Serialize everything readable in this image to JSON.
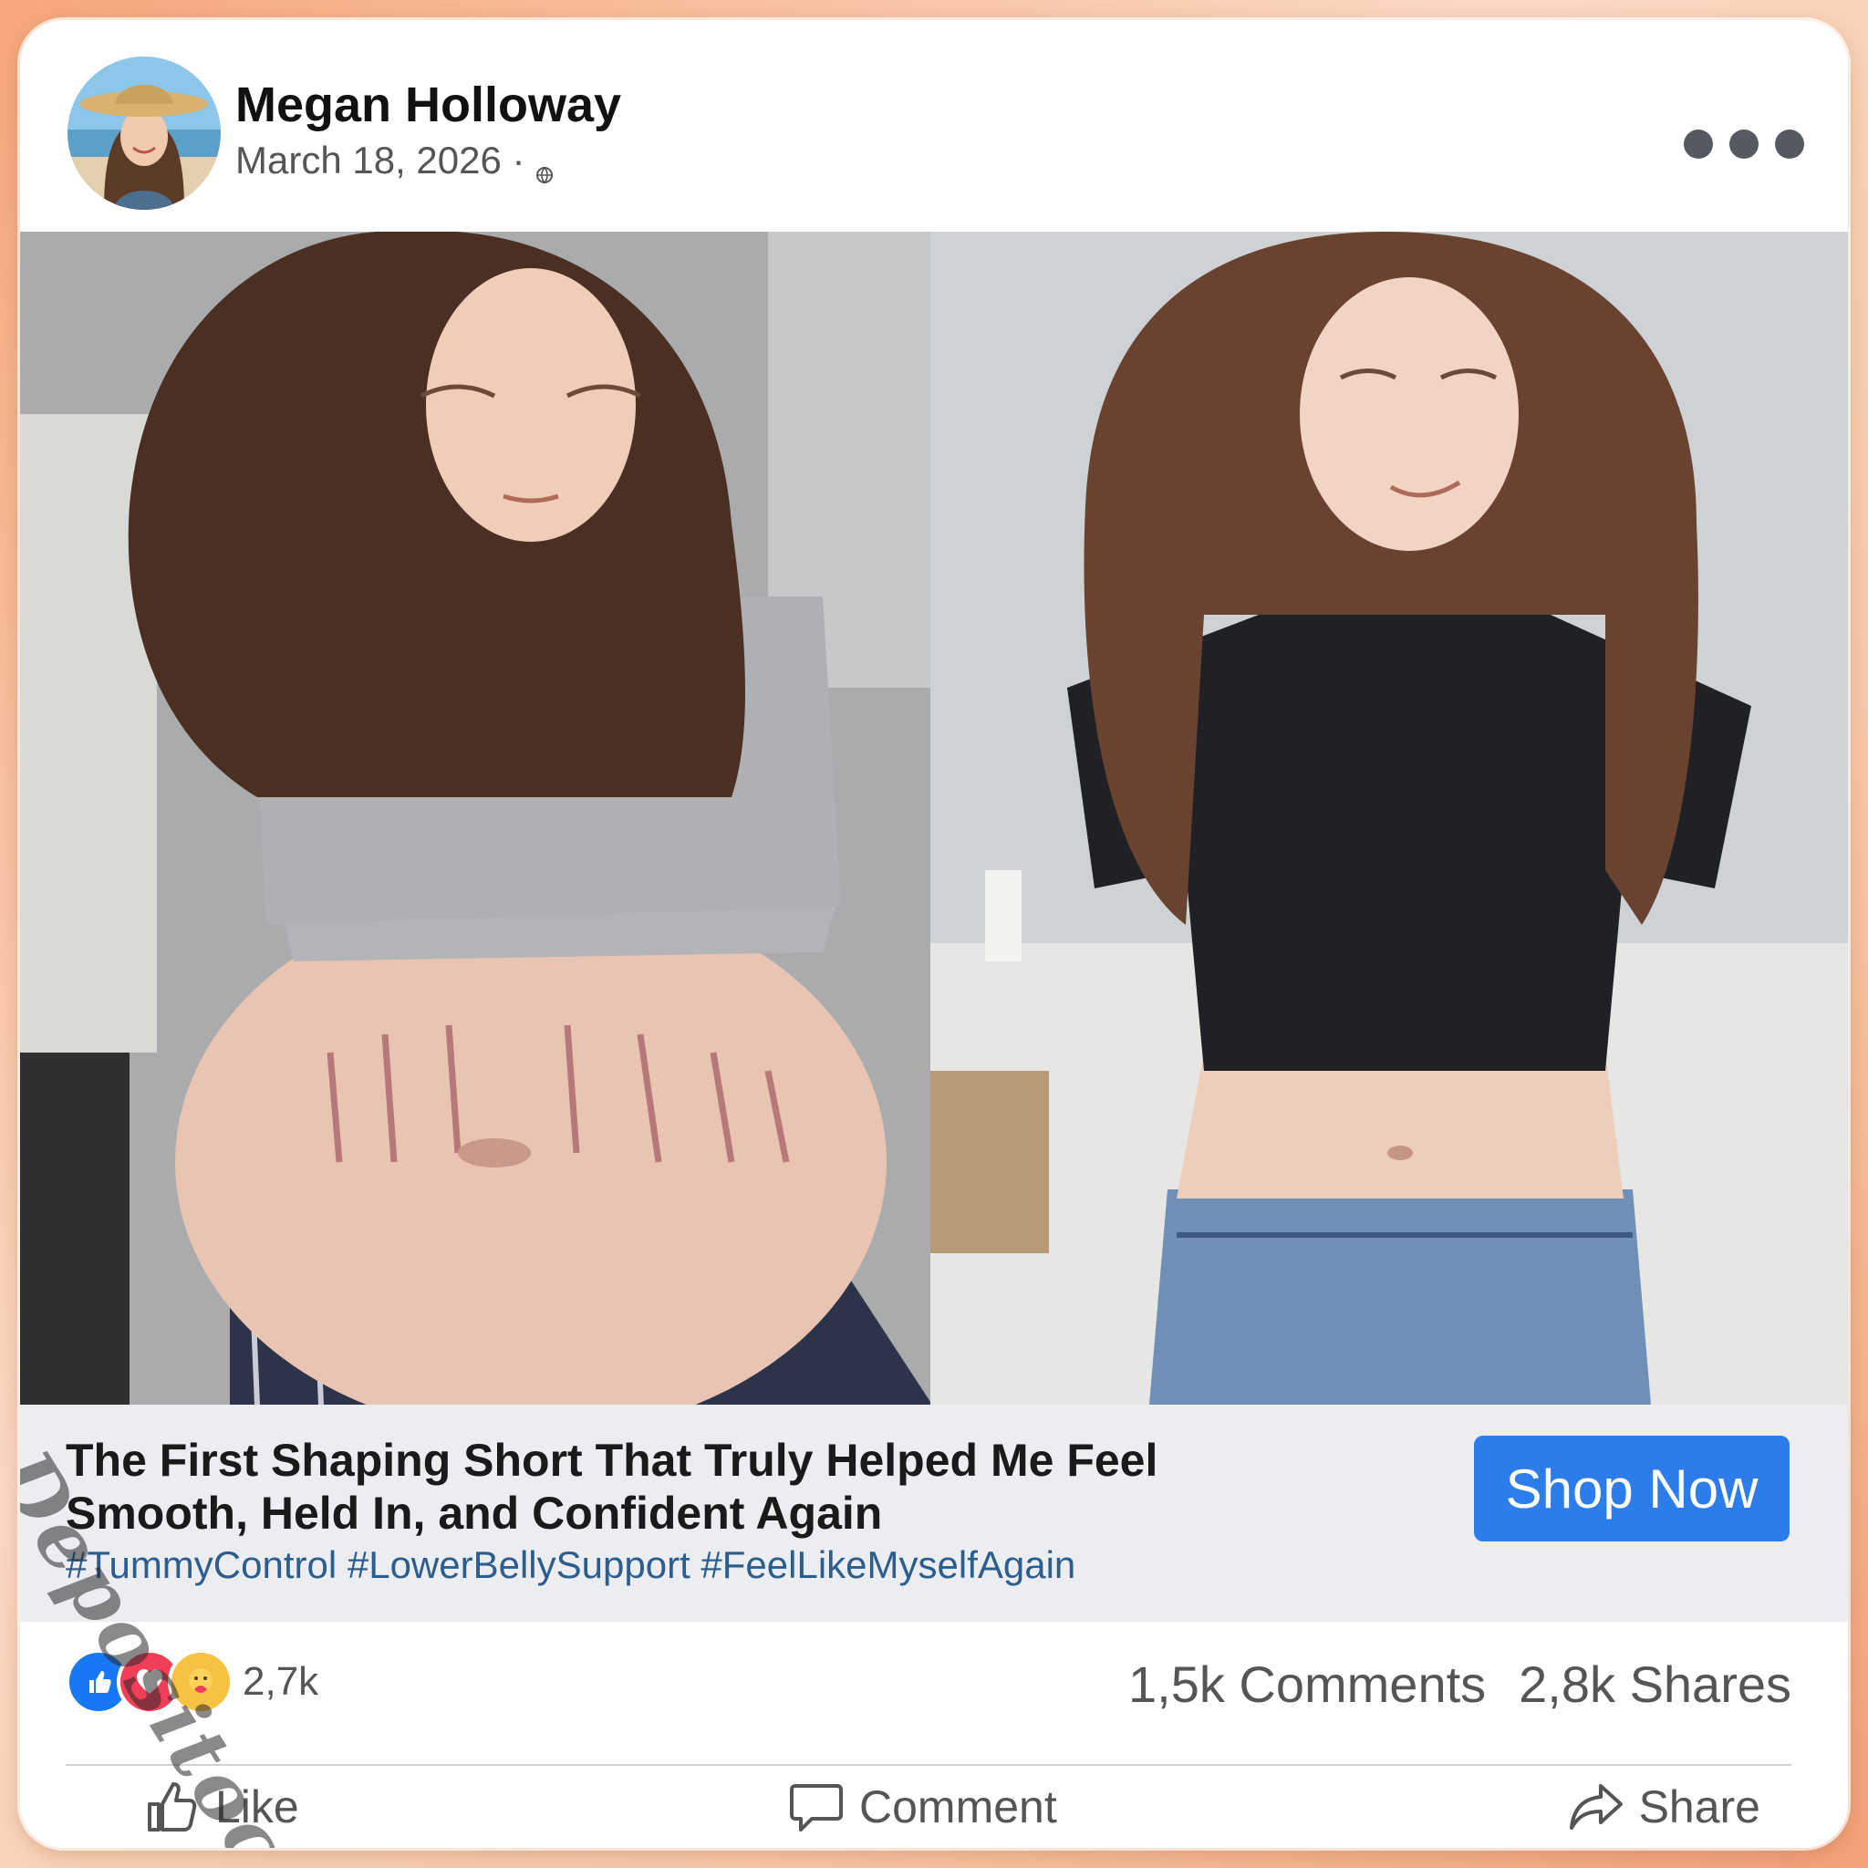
{
  "post": {
    "author": "Megan Holloway",
    "date": "March 18, 2026 ·",
    "privacy_icon": "globe-icon",
    "more_icon": "more-dots-icon"
  },
  "images": {
    "before_alt": "before-photo",
    "after_alt": "after-photo"
  },
  "ad": {
    "title": "The First Shaping Short That Truly Helped Me Feel Smooth, Held In, and Confident Again",
    "hashtags": "#TummyControl #LowerBellySupport #FeelLikeMyselfAgain",
    "cta": "Shop Now",
    "cta_color": "#2d7cec"
  },
  "stats": {
    "reactions": [
      "like",
      "love",
      "care"
    ],
    "reaction_count": "2,7k",
    "comments": "1,5k Comments",
    "shares": "2,8k Shares"
  },
  "actions": {
    "like": "Like",
    "comment": "Comment",
    "share": "Share"
  },
  "watermark": "Depositock"
}
